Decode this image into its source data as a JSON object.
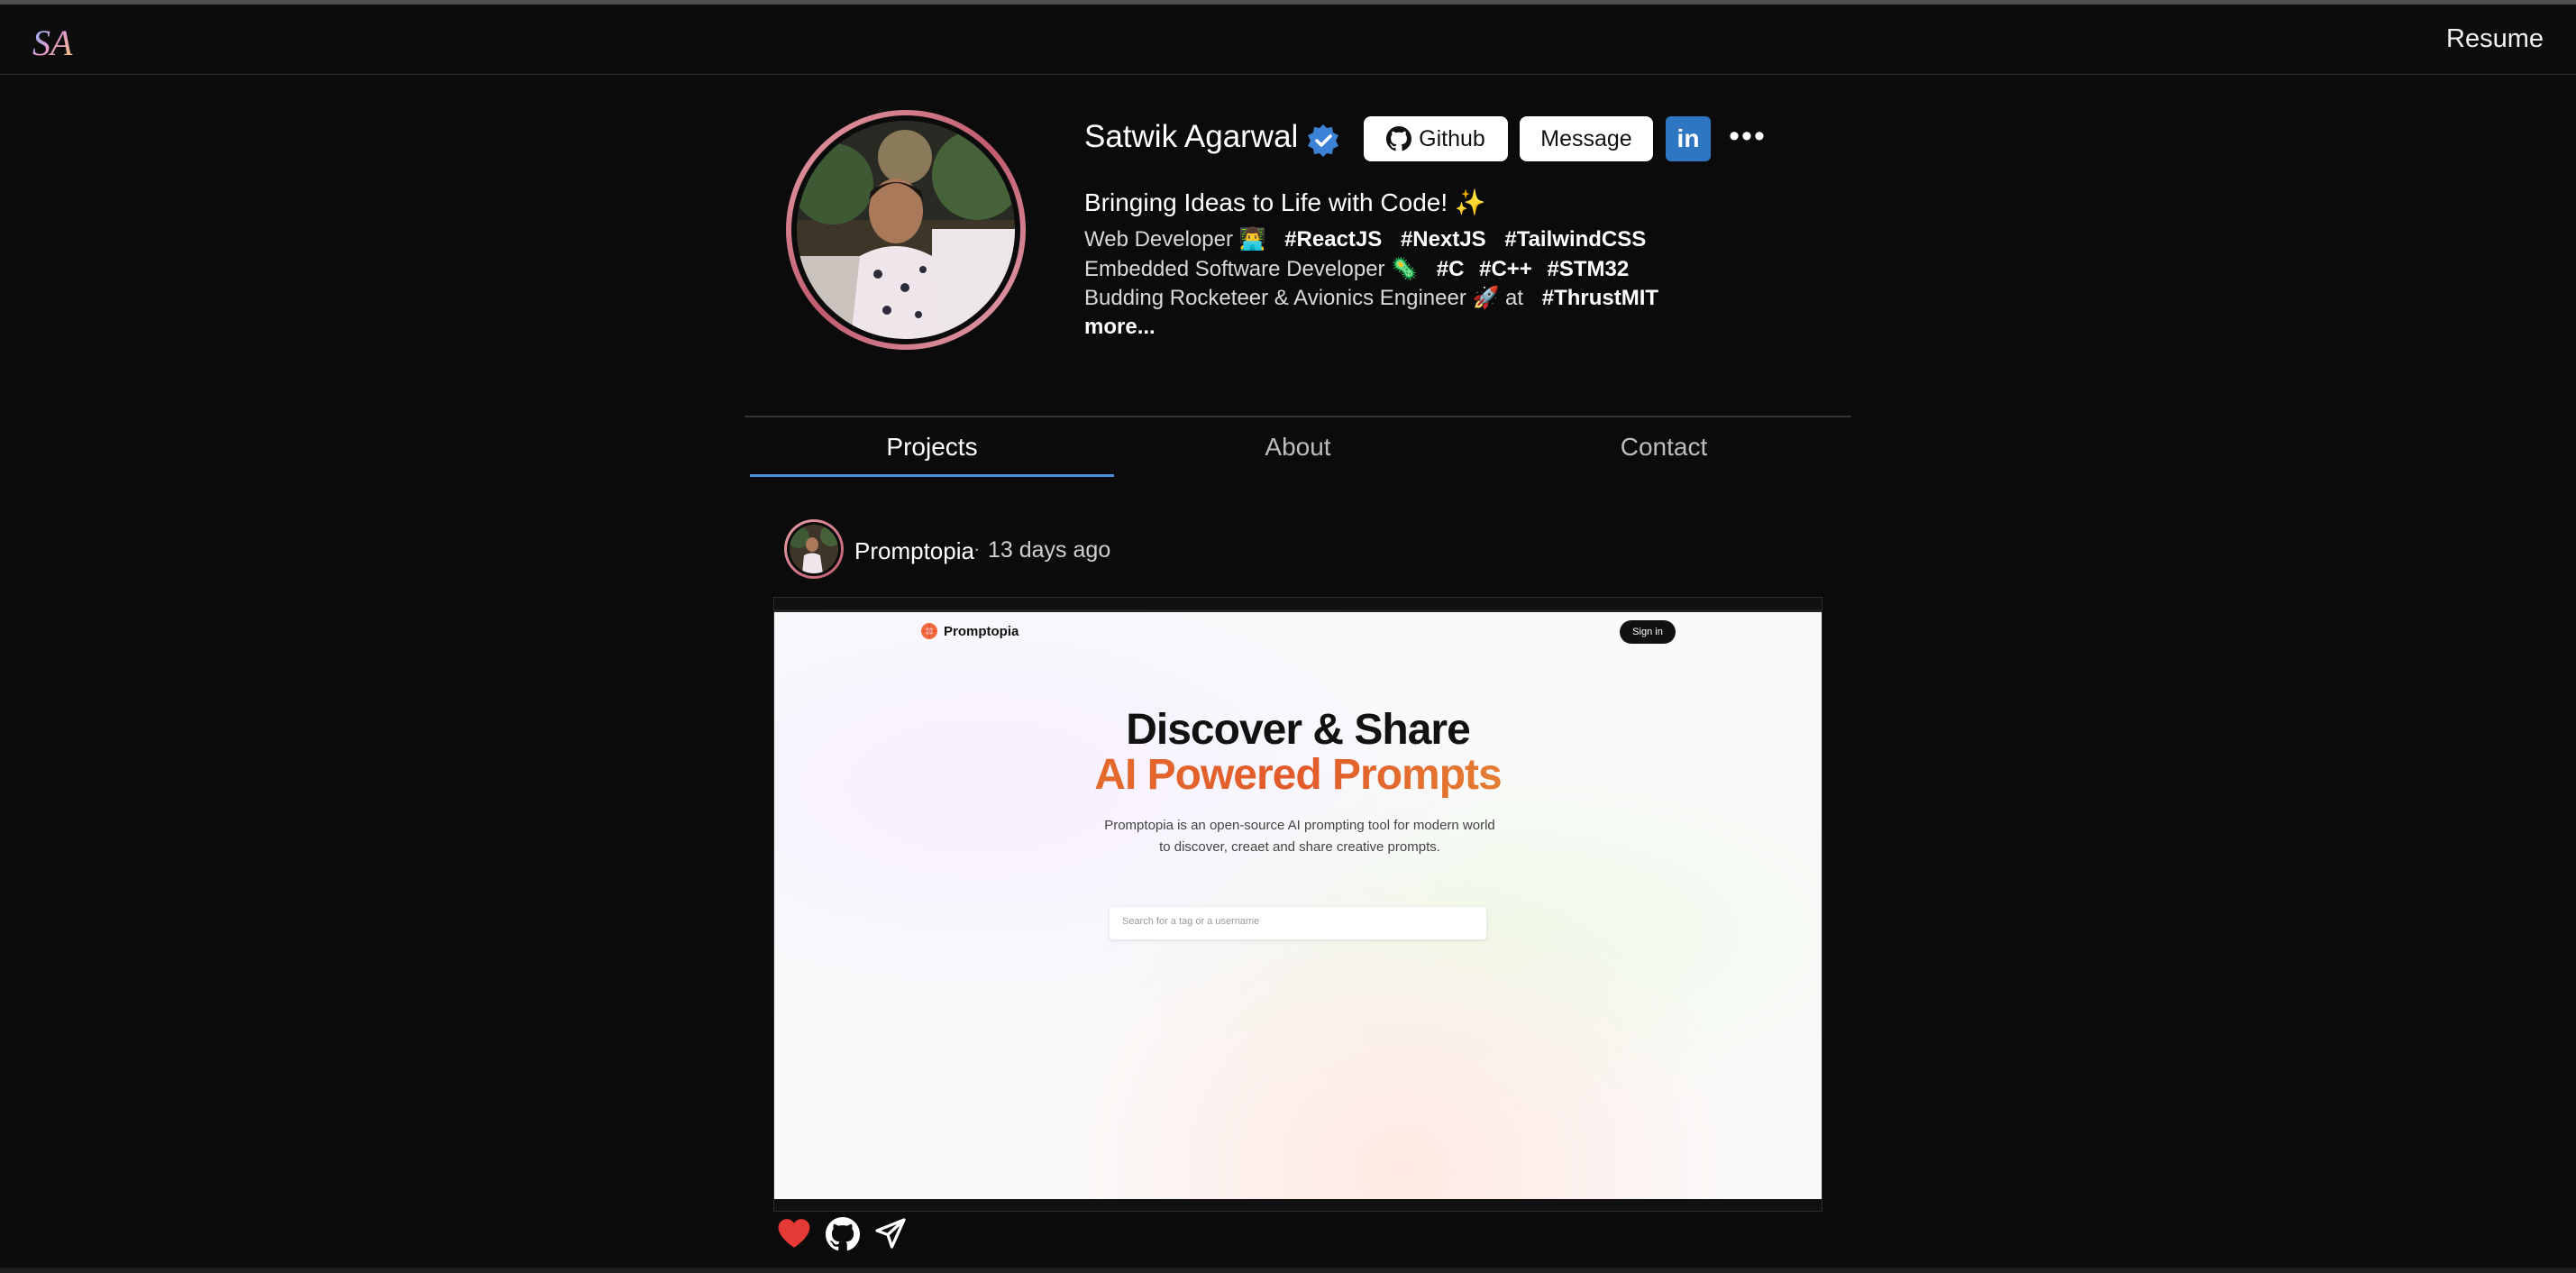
{
  "header": {
    "logo_text": "SA",
    "resume_label": "Resume"
  },
  "profile": {
    "name": "Satwik Agarwal",
    "buttons": {
      "github": "Github",
      "message": "Message",
      "linkedin": "in",
      "more": "•••"
    },
    "tagline": "Bringing Ideas to Life with Code! ✨",
    "bio": [
      {
        "text": "Web Developer 👨‍💻",
        "tags": [
          "#ReactJS",
          "#NextJS",
          "#TailwindCSS"
        ]
      },
      {
        "text": "Embedded Software Developer 🦠",
        "tags": [
          "#C",
          "#C++",
          "#STM32"
        ]
      },
      {
        "text": "Budding Rocketeer & Avionics Engineer 🚀 at",
        "tags": [
          "#ThrustMIT"
        ]
      }
    ],
    "more_label": "more..."
  },
  "tabs": [
    {
      "label": "Projects",
      "active": true
    },
    {
      "label": "About",
      "active": false
    },
    {
      "label": "Contact",
      "active": false
    }
  ],
  "post": {
    "title": "Promptopia",
    "separator": "·",
    "time": "13 days ago",
    "screenshot": {
      "brand": "Promptopia",
      "signin": "Sign in",
      "heading_line1": "Discover & Share",
      "heading_line2": "AI Powered Prompts",
      "description": "Promptopia is an open-source AI prompting tool for modern world to discover, creaet and share creative prompts.",
      "search_placeholder": "Search for a tag or a username"
    },
    "actions": [
      "heart-icon",
      "github-icon",
      "send-icon"
    ]
  },
  "colors": {
    "accent": "#4a90e2",
    "linkedin": "#2f76c2",
    "like": "#e53935",
    "ring": "#c05a6e"
  }
}
